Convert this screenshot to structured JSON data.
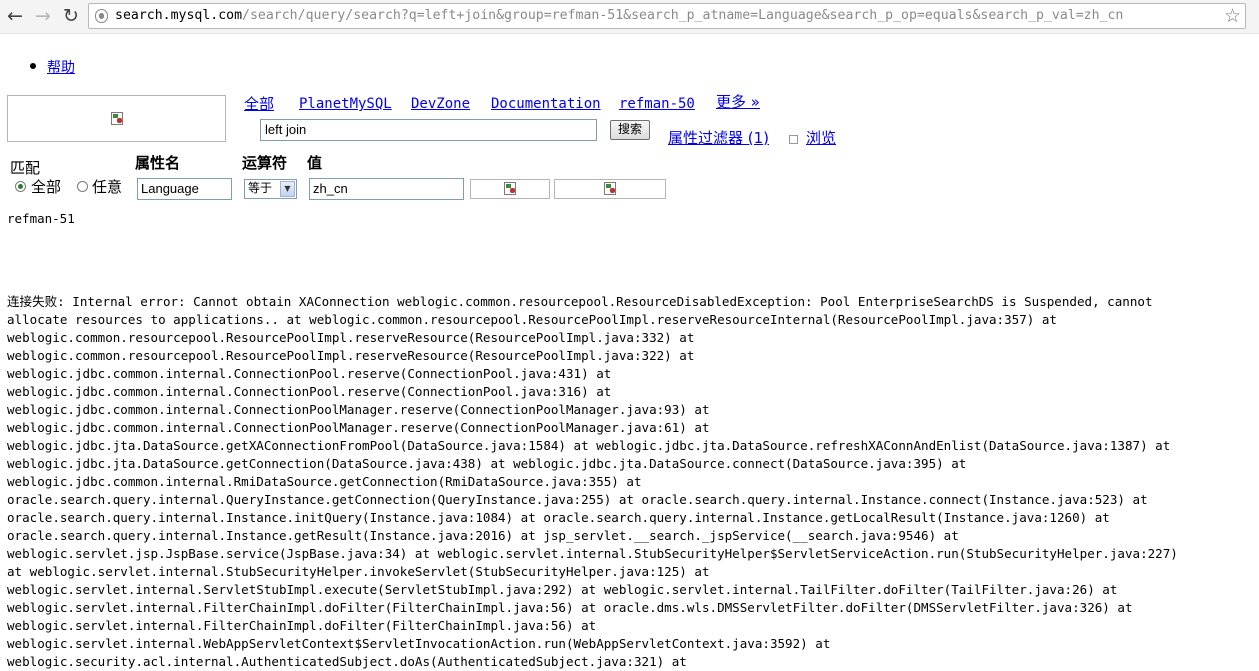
{
  "browser": {
    "back_icon": "back-arrow-icon",
    "forward_icon": "forward-arrow-icon",
    "reload_icon": "reload-icon",
    "url_host": "search.mysql.com",
    "url_path": "/search/query/search?q=left+join&group=refman-51&search_p_atname=Language&search_p_op=equals&search_p_val=zh_cn",
    "bookmark_icon": "star-icon"
  },
  "help_link": "帮助",
  "tabs": [
    {
      "label": "全部"
    },
    {
      "label": "PlanetMySQL"
    },
    {
      "label": "DevZone"
    },
    {
      "label": "Documentation"
    },
    {
      "label": "refman-50"
    },
    {
      "label": "更多 »"
    }
  ],
  "search": {
    "query": "left join",
    "button_label": "搜索",
    "filter_link": "属性过滤器 (1)",
    "browse_link": "浏览"
  },
  "attr_filter": {
    "match_label": "匹配",
    "match_all": "全部",
    "match_any": "任意",
    "attr_name_header": "属性名",
    "operator_header": "运算符",
    "value_header": "值",
    "attr_name_value": "Language",
    "operator_value": "等于",
    "value_value": "zh_cn"
  },
  "group_label": "refman-51",
  "error_lines": [
    "连接失败: Internal error: Cannot obtain XAConnection weblogic.common.resourcepool.ResourceDisabledException: Pool EnterpriseSearchDS is Suspended, cannot",
    "allocate resources to applications.. at weblogic.common.resourcepool.ResourcePoolImpl.reserveResourceInternal(ResourcePoolImpl.java:357) at",
    "weblogic.common.resourcepool.ResourcePoolImpl.reserveResource(ResourcePoolImpl.java:332) at",
    "weblogic.common.resourcepool.ResourcePoolImpl.reserveResource(ResourcePoolImpl.java:322) at",
    "weblogic.jdbc.common.internal.ConnectionPool.reserve(ConnectionPool.java:431) at",
    "weblogic.jdbc.common.internal.ConnectionPool.reserve(ConnectionPool.java:316) at",
    "weblogic.jdbc.common.internal.ConnectionPoolManager.reserve(ConnectionPoolManager.java:93) at",
    "weblogic.jdbc.common.internal.ConnectionPoolManager.reserve(ConnectionPoolManager.java:61) at",
    "weblogic.jdbc.jta.DataSource.getXAConnectionFromPool(DataSource.java:1584) at weblogic.jdbc.jta.DataSource.refreshXAConnAndEnlist(DataSource.java:1387) at",
    "weblogic.jdbc.jta.DataSource.getConnection(DataSource.java:438) at weblogic.jdbc.jta.DataSource.connect(DataSource.java:395) at",
    "weblogic.jdbc.common.internal.RmiDataSource.getConnection(RmiDataSource.java:355) at",
    "oracle.search.query.internal.QueryInstance.getConnection(QueryInstance.java:255) at oracle.search.query.internal.Instance.connect(Instance.java:523) at",
    "oracle.search.query.internal.Instance.initQuery(Instance.java:1084) at oracle.search.query.internal.Instance.getLocalResult(Instance.java:1260) at",
    "oracle.search.query.internal.Instance.getResult(Instance.java:2016) at jsp_servlet.__search._jspService(__search.java:9546) at",
    "weblogic.servlet.jsp.JspBase.service(JspBase.java:34) at weblogic.servlet.internal.StubSecurityHelper$ServletServiceAction.run(StubSecurityHelper.java:227)",
    "at weblogic.servlet.internal.StubSecurityHelper.invokeServlet(StubSecurityHelper.java:125) at",
    "weblogic.servlet.internal.ServletStubImpl.execute(ServletStubImpl.java:292) at weblogic.servlet.internal.TailFilter.doFilter(TailFilter.java:26) at",
    "weblogic.servlet.internal.FilterChainImpl.doFilter(FilterChainImpl.java:56) at oracle.dms.wls.DMSServletFilter.doFilter(DMSServletFilter.java:326) at",
    "weblogic.servlet.internal.FilterChainImpl.doFilter(FilterChainImpl.java:56) at",
    "weblogic.servlet.internal.WebAppServletContext$ServletInvocationAction.run(WebAppServletContext.java:3592) at",
    "weblogic.security.acl.internal.AuthenticatedSubject.doAs(AuthenticatedSubject.java:321) at"
  ]
}
